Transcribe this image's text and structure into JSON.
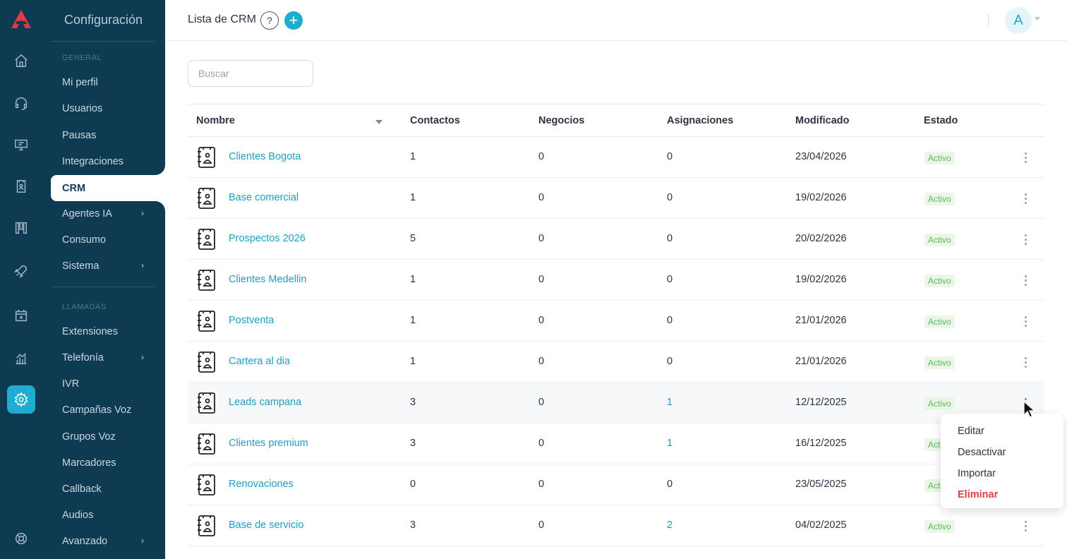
{
  "app": {
    "section_title": "Configuración",
    "page_title": "Lista de CRM",
    "help_label": "?",
    "add_label": "+",
    "user_initial": "A"
  },
  "sidebar": {
    "general_label": "GENERAL",
    "calls_label": "LLAMADAS",
    "general_items": [
      {
        "label": "Mi perfil"
      },
      {
        "label": "Usuarios"
      },
      {
        "label": "Pausas"
      },
      {
        "label": "Integraciones"
      },
      {
        "label": "CRM"
      },
      {
        "label": "Agentes IA",
        "has_children": true
      },
      {
        "label": "Consumo"
      },
      {
        "label": "Sistema",
        "has_children": true
      }
    ],
    "call_items": [
      {
        "label": "Extensiones"
      },
      {
        "label": "Telefonía",
        "has_children": true
      },
      {
        "label": "IVR"
      },
      {
        "label": "Campañas Voz"
      },
      {
        "label": "Grupos Voz"
      },
      {
        "label": "Marcadores"
      },
      {
        "label": "Callback"
      },
      {
        "label": "Audios"
      },
      {
        "label": "Avanzado",
        "has_children": true
      }
    ],
    "active": "CRM"
  },
  "rail": {
    "icons": [
      "home-icon",
      "headset-icon",
      "monitor-icon",
      "contact-book-icon",
      "columns-icon",
      "rocket-icon",
      "calendar-icon",
      "chart-icon",
      "gear-icon",
      "lifebuoy-icon"
    ],
    "active": "gear-icon"
  },
  "search": {
    "placeholder": "Buscar",
    "value": ""
  },
  "table": {
    "headers": {
      "name": "Nombre",
      "contacts": "Contactos",
      "deals": "Negocios",
      "assignments": "Asignaciones",
      "modified": "Modificado",
      "status": "Estado"
    },
    "rows": [
      {
        "name": "Clientes Bogota",
        "contacts": "1",
        "deals": "0",
        "assignments": "0",
        "modified": "23/04/2026",
        "status": "Activo"
      },
      {
        "name": "Base comercial",
        "contacts": "1",
        "deals": "0",
        "assignments": "0",
        "modified": "19/02/2026",
        "status": "Activo"
      },
      {
        "name": "Prospectos 2026",
        "contacts": "5",
        "deals": "0",
        "assignments": "0",
        "modified": "20/02/2026",
        "status": "Activo"
      },
      {
        "name": "Clientes Medellin",
        "contacts": "1",
        "deals": "0",
        "assignments": "0",
        "modified": "19/02/2026",
        "status": "Activo"
      },
      {
        "name": "Postventa",
        "contacts": "1",
        "deals": "0",
        "assignments": "0",
        "modified": "21/01/2026",
        "status": "Activo"
      },
      {
        "name": "Cartera al dia",
        "contacts": "1",
        "deals": "0",
        "assignments": "0",
        "modified": "21/01/2026",
        "status": "Activo"
      },
      {
        "name": "Leads campana",
        "contacts": "3",
        "deals": "0",
        "assignments": "1",
        "modified": "12/12/2025",
        "status": "Activo"
      },
      {
        "name": "Clientes premium",
        "contacts": "3",
        "deals": "0",
        "assignments": "1",
        "modified": "16/12/2025",
        "status": "Activo"
      },
      {
        "name": "Renovaciones",
        "contacts": "0",
        "deals": "0",
        "assignments": "0",
        "modified": "23/05/2025",
        "status": "Activo"
      },
      {
        "name": "Base de servicio",
        "contacts": "3",
        "deals": "0",
        "assignments": "2",
        "modified": "04/02/2025",
        "status": "Activo"
      }
    ],
    "hover_row": 6
  },
  "row_menu": {
    "items": [
      {
        "label": "Editar",
        "danger": false
      },
      {
        "label": "Desactivar",
        "danger": false
      },
      {
        "label": "Importar",
        "danger": false
      },
      {
        "label": "Eliminar",
        "danger": true
      }
    ]
  },
  "colors": {
    "sidebar_bg": "#0f3b52",
    "accent": "#1eaccf",
    "link": "#1e9fc2",
    "status_green": "#5cb85c",
    "danger": "#e53945"
  }
}
